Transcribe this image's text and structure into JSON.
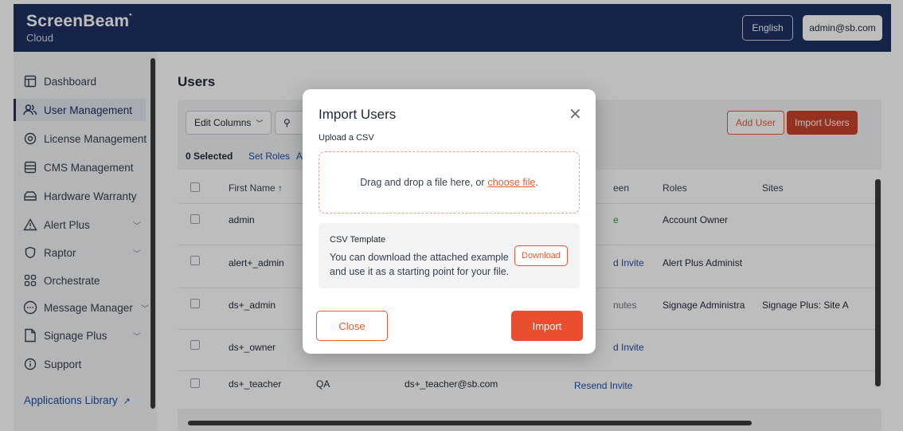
{
  "header": {
    "brand": "ScreenBeam",
    "brand_mark": "•",
    "sub": "Cloud",
    "language": "English",
    "user": "admin@sb.com"
  },
  "sidebar": {
    "items": [
      {
        "label": "Dashboard",
        "icon": "dashboard-icon"
      },
      {
        "label": "User Management",
        "icon": "users-icon"
      },
      {
        "label": "License Management",
        "icon": "license-icon"
      },
      {
        "label": "CMS Management",
        "icon": "database-icon"
      },
      {
        "label": "Hardware Warranty",
        "icon": "warranty-icon"
      },
      {
        "label": "Alert Plus",
        "icon": "alert-icon"
      },
      {
        "label": "Raptor",
        "icon": "shield-icon"
      },
      {
        "label": "Orchestrate",
        "icon": "grid-icon"
      },
      {
        "label": "Message Manager",
        "icon": "chat-icon"
      },
      {
        "label": "Signage Plus",
        "icon": "file-icon"
      },
      {
        "label": "Support",
        "icon": "info-icon"
      }
    ],
    "applications_library": "Applications Library"
  },
  "main": {
    "title": "Users",
    "edit_columns": "Edit Columns",
    "add_user": "Add User",
    "import_users": "Import Users",
    "selected": "0 Selected",
    "set_roles": "Set Roles",
    "set_roles_trail": "A",
    "columns": [
      "First Name ↑",
      "een",
      "Roles",
      "Sites"
    ],
    "rows": [
      {
        "first": "admin",
        "last": "",
        "email": "",
        "seen": "e",
        "role": "Account Owner",
        "site": ""
      },
      {
        "first": "alert+_admin",
        "last": "",
        "email": "",
        "seen": "d Invite",
        "role": "Alert Plus Administ",
        "site": ""
      },
      {
        "first": "ds+_admin",
        "last": "",
        "email": "",
        "seen": "nutes",
        "role": "Signage Administra",
        "site": "Signage Plus: Site A"
      },
      {
        "first": "ds+_owner",
        "last": "",
        "email": "",
        "seen": "d Invite",
        "role": "",
        "site": ""
      },
      {
        "first": "ds+_teacher",
        "last": "QA",
        "email": "ds+_teacher@sb.com",
        "seen": "Resend Invite",
        "role": "",
        "site": ""
      }
    ]
  },
  "modal": {
    "title": "Import Users",
    "close_symbol": "✕",
    "upload_label": "Upload a CSV",
    "drop_text": "Drag and drop a file here, or",
    "choose_file": "choose file",
    "drop_end": ".",
    "template_title": "CSV Template",
    "template_text": "You can download the attached example and use it as a starting point for your file.",
    "download": "Download",
    "close_button": "Close",
    "import_button": "Import"
  },
  "colors": {
    "header_bg": "#1e3163",
    "accent": "#e94e2f",
    "link": "#1e4ea8"
  }
}
